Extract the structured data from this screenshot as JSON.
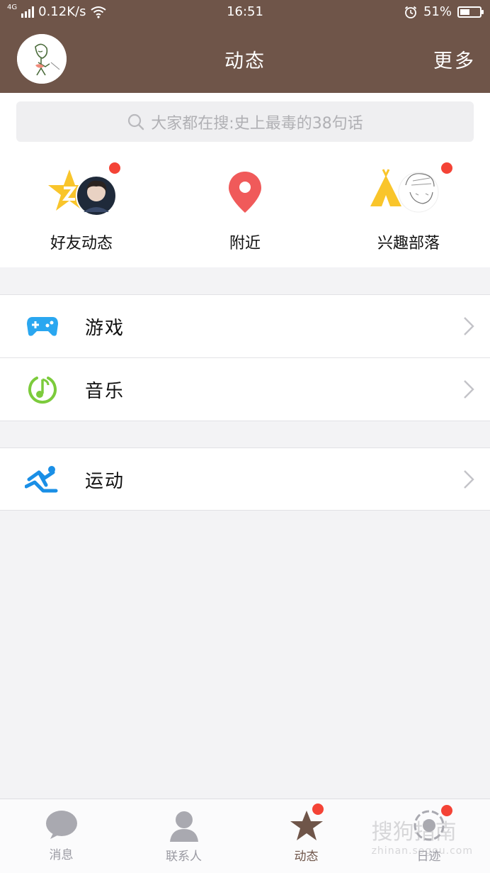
{
  "status": {
    "network": "4G",
    "speed": "0.12K/s",
    "time": "16:51",
    "battery": "51%",
    "battery_level": 0.51
  },
  "header": {
    "title": "动态",
    "more": "更多"
  },
  "search": {
    "placeholder": "大家都在搜:史上最毒的38句话"
  },
  "quick": [
    {
      "label": "好友动态",
      "icon": "star-avatar-icon",
      "badge": true
    },
    {
      "label": "附近",
      "icon": "location-pin-icon",
      "badge": false
    },
    {
      "label": "兴趣部落",
      "icon": "tent-icon",
      "badge": true
    }
  ],
  "list": [
    {
      "label": "游戏",
      "icon": "gamepad-icon"
    },
    {
      "label": "音乐",
      "icon": "music-note-icon"
    },
    {
      "label": "运动",
      "icon": "run-icon"
    }
  ],
  "tabs": [
    {
      "label": "消息",
      "icon": "chat-bubble-icon",
      "active": false,
      "badge": false
    },
    {
      "label": "联系人",
      "icon": "contact-person-icon",
      "active": false,
      "badge": false
    },
    {
      "label": "动态",
      "icon": "star-icon",
      "active": true,
      "badge": true
    },
    {
      "label": "日迹",
      "icon": "camera-lens-icon",
      "active": false,
      "badge": true
    }
  ],
  "watermark": {
    "text": "搜狗指南",
    "sub": "zhinan.sogou.com"
  },
  "colors": {
    "header_bg": "#6f5549",
    "badge": "#f44336",
    "game_blue": "#2aa7f0",
    "music_green": "#7ccb3c",
    "run_blue": "#1a8fe6",
    "pin_red": "#f05a5a",
    "yellow": "#f9c52b"
  }
}
